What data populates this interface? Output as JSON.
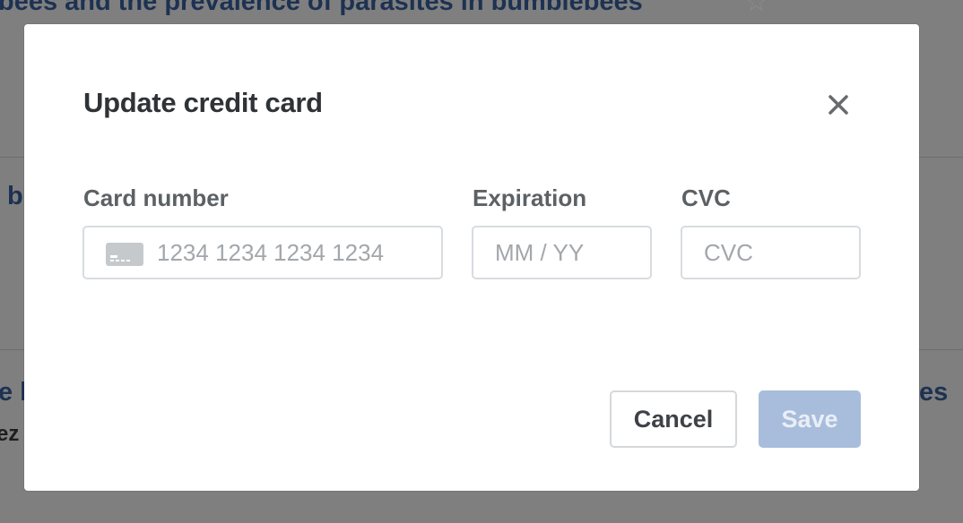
{
  "background": {
    "titles": [
      "bees and the prevalence of parasites in bumblebees",
      "b",
      "e l",
      "es"
    ],
    "subtitle": "ez"
  },
  "modal": {
    "title": "Update credit card",
    "close_icon": "close-icon",
    "fields": {
      "card_number": {
        "label": "Card number",
        "placeholder": "1234 1234 1234 1234",
        "icon": "credit-card-icon"
      },
      "expiration": {
        "label": "Expiration",
        "placeholder": "MM / YY"
      },
      "cvc": {
        "label": "CVC",
        "placeholder": "CVC"
      }
    },
    "buttons": {
      "cancel": "Cancel",
      "save": "Save"
    },
    "colors": {
      "save_disabled_bg": "#a8bddb",
      "title": "#2f3337",
      "label": "#5c6166"
    }
  }
}
